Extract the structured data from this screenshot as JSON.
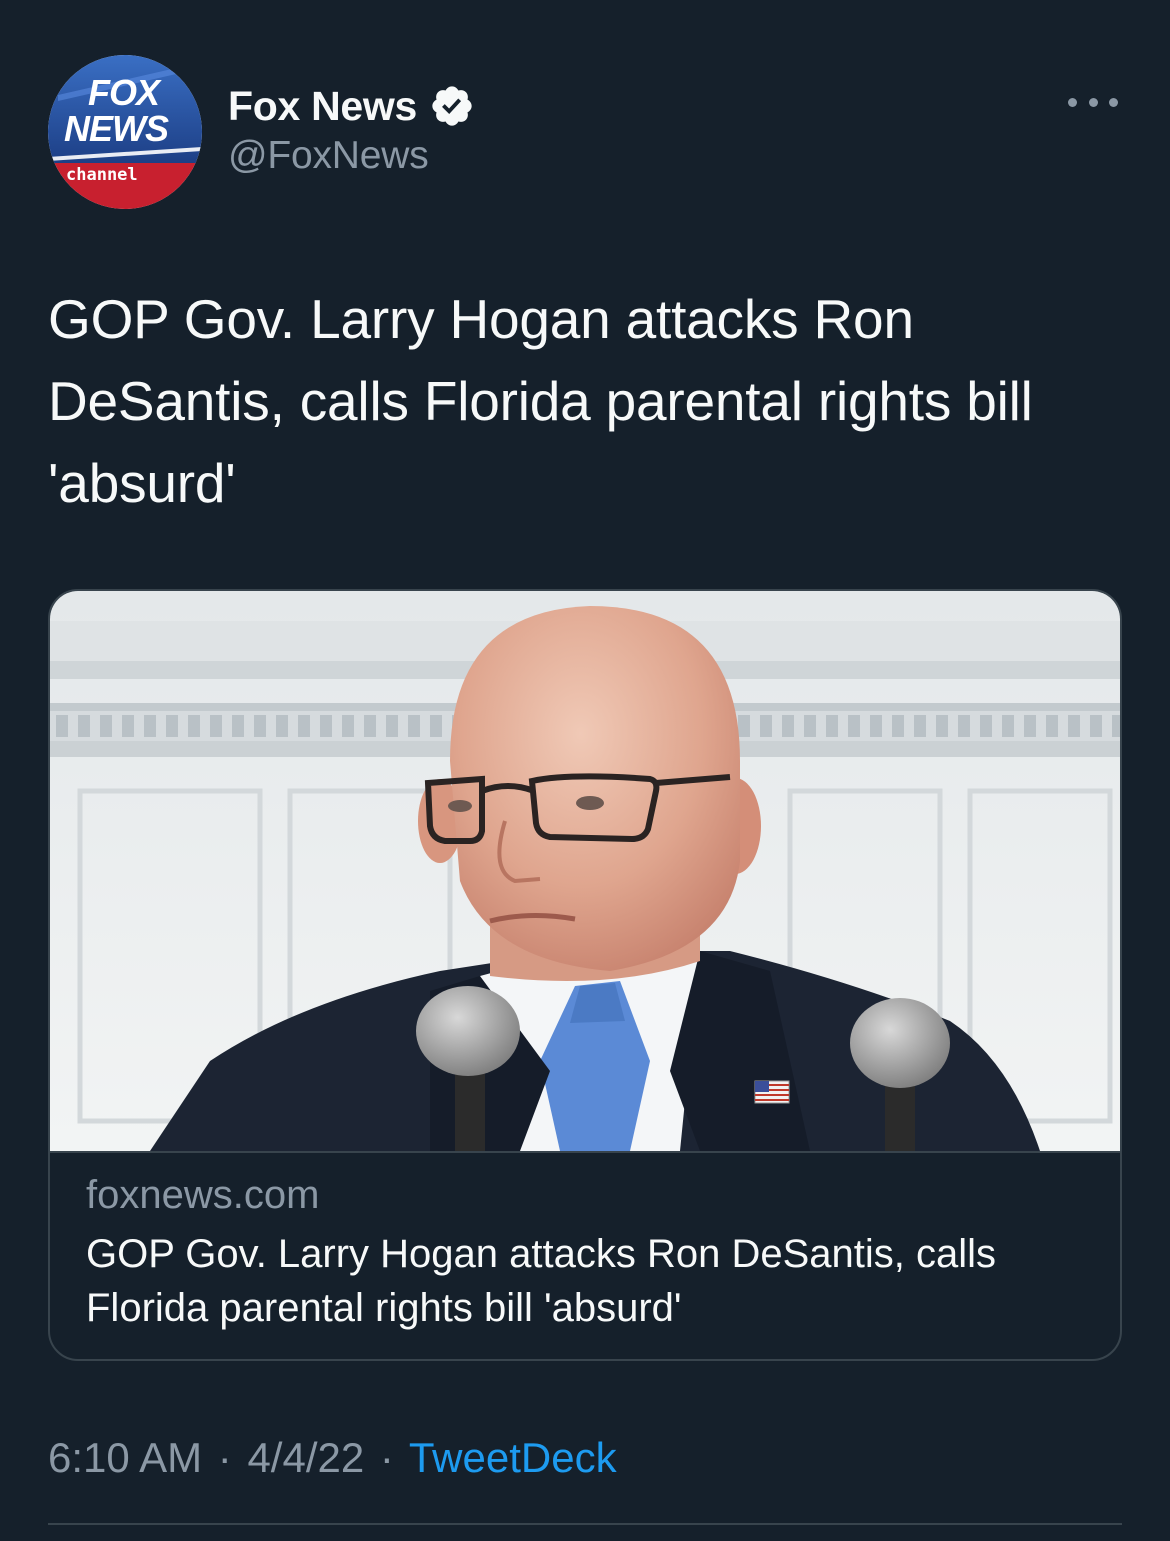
{
  "author": {
    "display_name": "Fox News",
    "handle": "@FoxNews",
    "verified": true,
    "avatar_text": {
      "line1": "FOX",
      "line2": "NEWS",
      "line3": "channel"
    }
  },
  "tweet": {
    "text": "GOP Gov. Larry Hogan attacks Ron DeSantis, calls Florida parental rights bill 'absurd'"
  },
  "card": {
    "domain": "foxnews.com",
    "title": "GOP Gov. Larry Hogan attacks Ron DeSantis, calls Florida parental rights bill 'absurd'"
  },
  "meta": {
    "time": "6:10 AM",
    "separator": "·",
    "date": "4/4/22",
    "source": "TweetDeck"
  },
  "colors": {
    "background": "#15202b",
    "text_primary": "#f7f9f9",
    "text_secondary": "#8b98a5",
    "accent": "#1d9bf0",
    "border": "#38444d"
  },
  "icons": {
    "verified": "verified-badge-icon",
    "more": "more-horizontal-icon"
  }
}
